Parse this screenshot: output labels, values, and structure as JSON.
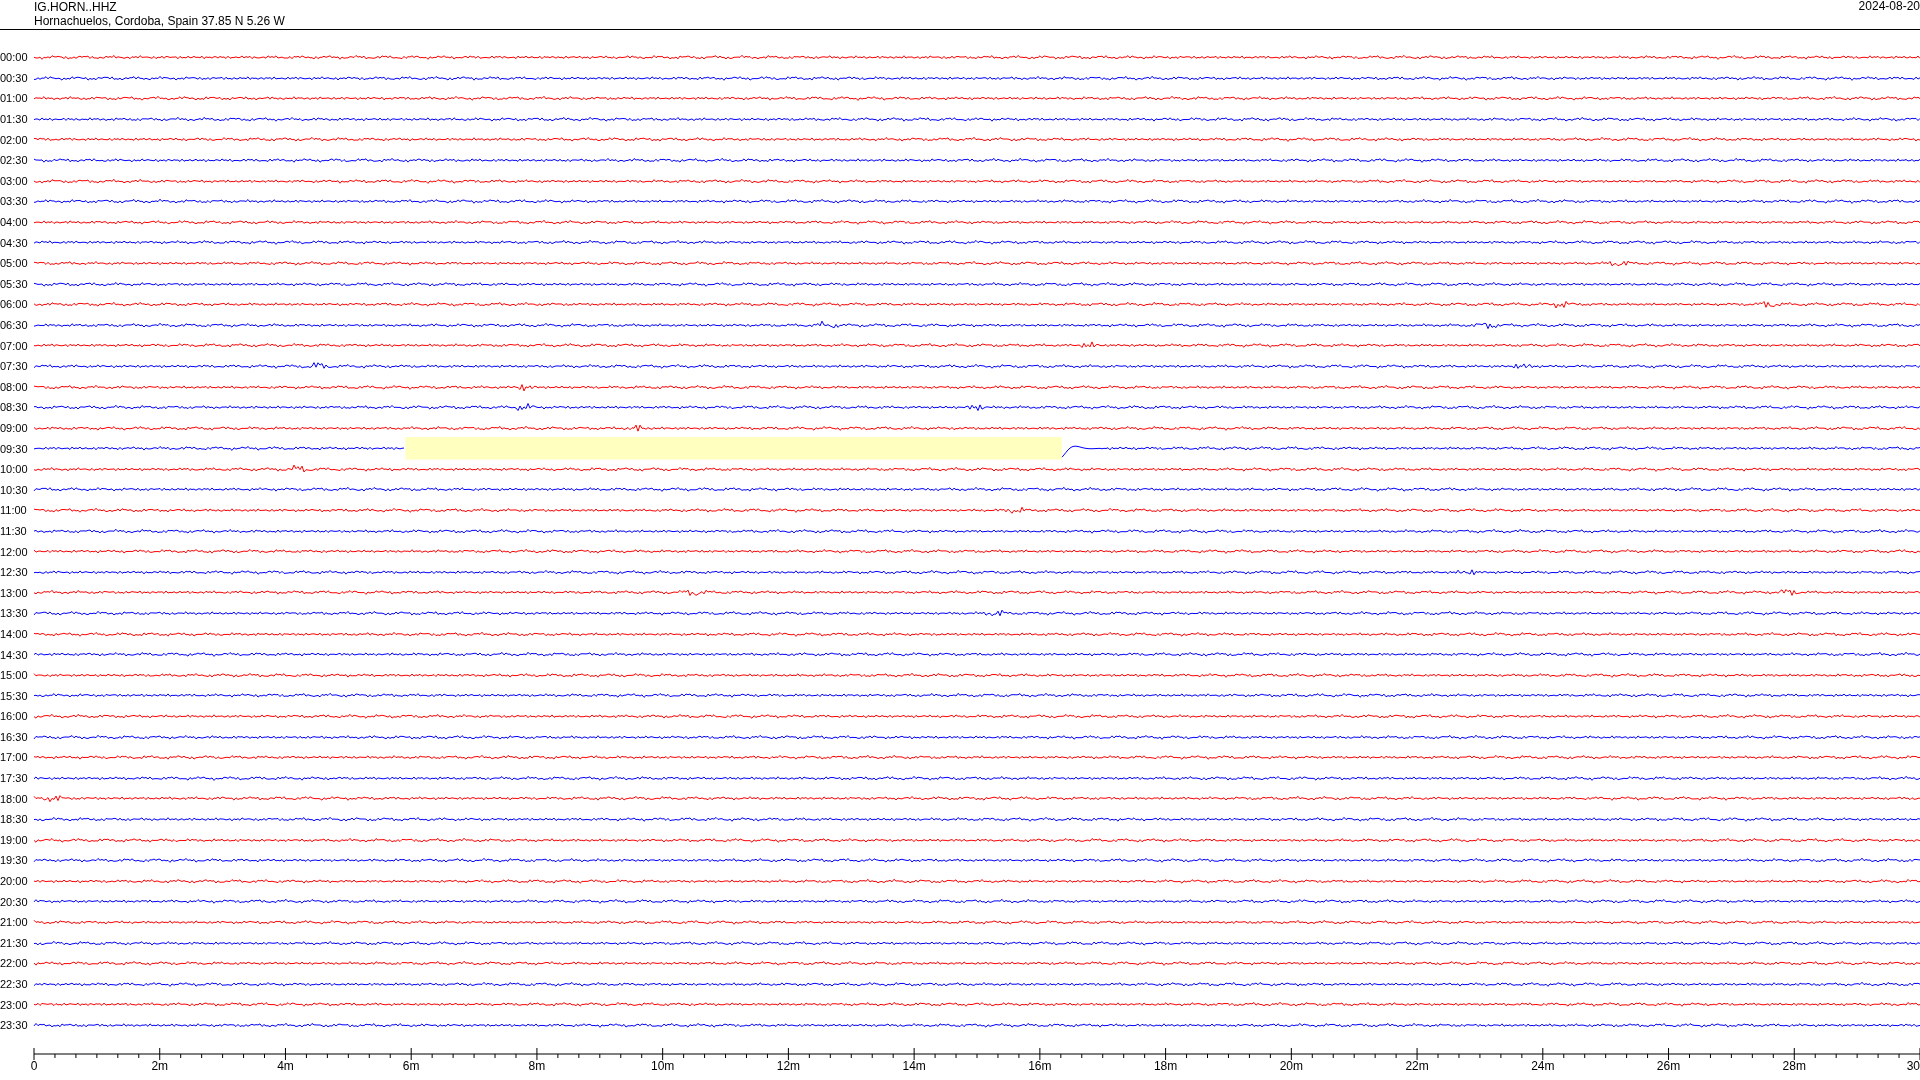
{
  "header": {
    "station": "IG.HORN..HHZ",
    "location": "Hornachuelos, Cordoba, Spain  37.85 N 5.26 W",
    "date": "2024-08-20"
  },
  "rows": [
    {
      "label": "00:00",
      "color": "#ff0000",
      "highlighted": false
    },
    {
      "label": "00:30",
      "color": "#0000ff",
      "highlighted": false
    },
    {
      "label": "01:00",
      "color": "#ff0000",
      "highlighted": false
    },
    {
      "label": "01:30",
      "color": "#0000ff",
      "highlighted": false
    },
    {
      "label": "02:00",
      "color": "#ff0000",
      "highlighted": false
    },
    {
      "label": "02:30",
      "color": "#0000ff",
      "highlighted": false
    },
    {
      "label": "03:00",
      "color": "#ff0000",
      "highlighted": false
    },
    {
      "label": "03:30",
      "color": "#0000ff",
      "highlighted": false
    },
    {
      "label": "04:00",
      "color": "#ff0000",
      "highlighted": false
    },
    {
      "label": "04:30",
      "color": "#0000ff",
      "highlighted": false
    },
    {
      "label": "05:00",
      "color": "#ff0000",
      "highlighted": false
    },
    {
      "label": "05:30",
      "color": "#0000ff",
      "highlighted": false
    },
    {
      "label": "06:00",
      "color": "#ff0000",
      "highlighted": false
    },
    {
      "label": "06:30",
      "color": "#0000ff",
      "highlighted": false
    },
    {
      "label": "07:00",
      "color": "#ff0000",
      "highlighted": false
    },
    {
      "label": "07:30",
      "color": "#0000ff",
      "highlighted": false
    },
    {
      "label": "08:00",
      "color": "#ff0000",
      "highlighted": false
    },
    {
      "label": "08:30",
      "color": "#0000ff",
      "highlighted": false
    },
    {
      "label": "09:00",
      "color": "#ff0000",
      "highlighted": false
    },
    {
      "label": "09:30",
      "color": "#0000ff",
      "highlighted": true
    },
    {
      "label": "10:00",
      "color": "#ff0000",
      "highlighted": false
    },
    {
      "label": "10:30",
      "color": "#0000ff",
      "highlighted": false
    },
    {
      "label": "11:00",
      "color": "#ff0000",
      "highlighted": false
    },
    {
      "label": "11:30",
      "color": "#0000ff",
      "highlighted": false
    },
    {
      "label": "12:00",
      "color": "#ff0000",
      "highlighted": false
    },
    {
      "label": "12:30",
      "color": "#0000ff",
      "highlighted": false
    },
    {
      "label": "13:00",
      "color": "#ff0000",
      "highlighted": false
    },
    {
      "label": "13:30",
      "color": "#0000ff",
      "highlighted": false
    },
    {
      "label": "14:00",
      "color": "#ff0000",
      "highlighted": false
    },
    {
      "label": "14:30",
      "color": "#0000ff",
      "highlighted": false
    },
    {
      "label": "15:00",
      "color": "#ff0000",
      "highlighted": false
    },
    {
      "label": "15:30",
      "color": "#0000ff",
      "highlighted": false
    },
    {
      "label": "16:00",
      "color": "#ff0000",
      "highlighted": false
    },
    {
      "label": "16:30",
      "color": "#0000ff",
      "highlighted": false
    },
    {
      "label": "17:00",
      "color": "#ff0000",
      "highlighted": false
    },
    {
      "label": "17:30",
      "color": "#0000ff",
      "highlighted": false
    },
    {
      "label": "18:00",
      "color": "#ff0000",
      "highlighted": false
    },
    {
      "label": "18:30",
      "color": "#0000ff",
      "highlighted": false
    },
    {
      "label": "19:00",
      "color": "#ff0000",
      "highlighted": false
    },
    {
      "label": "19:30",
      "color": "#0000ff",
      "highlighted": false
    },
    {
      "label": "20:00",
      "color": "#ff0000",
      "highlighted": false
    },
    {
      "label": "20:30",
      "color": "#0000ff",
      "highlighted": false
    },
    {
      "label": "21:00",
      "color": "#ff0000",
      "highlighted": false
    },
    {
      "label": "21:30",
      "color": "#0000ff",
      "highlighted": false
    },
    {
      "label": "22:00",
      "color": "#ff0000",
      "highlighted": false
    },
    {
      "label": "22:30",
      "color": "#0000ff",
      "highlighted": false
    },
    {
      "label": "23:00",
      "color": "#ff0000",
      "highlighted": false
    },
    {
      "label": "23:30",
      "color": "#0000ff",
      "highlighted": false
    }
  ],
  "axis_labels": [
    "0",
    "2m",
    "4m",
    "6m",
    "8m",
    "10m",
    "12m",
    "14m",
    "16m",
    "18m",
    "20m",
    "22m",
    "24m",
    "26m",
    "28m",
    "30"
  ]
}
